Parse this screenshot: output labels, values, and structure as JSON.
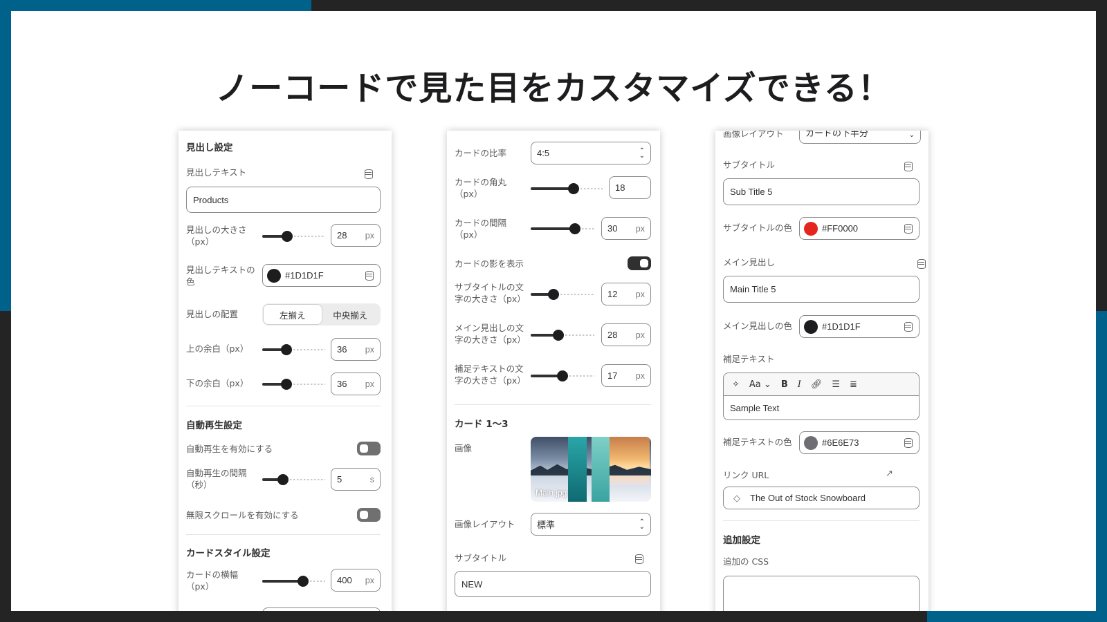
{
  "headline": "ノーコードで見た目をカスタマイズできる！",
  "colors": {
    "accent_blue": "#00628a",
    "dark": "#1d1d1f",
    "red": "#FF0000",
    "gray": "#6E6E73"
  },
  "icons": [
    "database-icon",
    "chevron-updown-icon",
    "external-link-icon",
    "tag-icon",
    "magic-icon",
    "bold-icon",
    "italic-icon",
    "link-icon",
    "bullet-list-icon",
    "numbered-list-icon"
  ],
  "panel1": {
    "heading_section": "見出し設定",
    "heading_text_label": "見出しテキスト",
    "heading_text_value": "Products",
    "heading_size_label": "見出しの大きさ（px）",
    "heading_size_value": "28",
    "heading_size_fraction": 0.4,
    "unit_px": "px",
    "heading_color_label": "見出しテキストの色",
    "heading_color_value": "#1D1D1F",
    "alignment_label": "見出しの配置",
    "alignment_options": [
      "左揃え",
      "中央揃え"
    ],
    "alignment_selected": "左揃え",
    "top_margin_label": "上の余白（px）",
    "top_margin_value": "36",
    "top_margin_fraction": 0.38,
    "bottom_margin_label": "下の余白（px）",
    "bottom_margin_value": "36",
    "bottom_margin_fraction": 0.38,
    "autoplay_section": "自動再生設定",
    "autoplay_enable_label": "自動再生を有効にする",
    "autoplay_enable_on": false,
    "autoplay_interval_label": "自動再生の間隔（秒）",
    "autoplay_interval_value": "5",
    "autoplay_interval_fraction": 0.33,
    "unit_s": "s",
    "infinite_scroll_label": "無限スクロールを有効にする",
    "infinite_scroll_on": false,
    "card_style_section": "カードスタイル設定",
    "card_width_label": "カードの横幅（px）",
    "card_width_value": "400",
    "card_width_fraction": 0.65
  },
  "panel2": {
    "ratio_label": "カードの比率",
    "ratio_value": "4:5",
    "corner_label": "カードの角丸（px）",
    "corner_value": "18",
    "corner_fraction": 0.6,
    "gap_label": "カードの間隔（px）",
    "gap_value": "30",
    "gap_fraction": 0.7,
    "unit_px": "px",
    "shadow_label": "カードの影を表示",
    "shadow_on": true,
    "subtitle_size_label": "サブタイトルの文字の大きさ（px）",
    "subtitle_size_value": "12",
    "subtitle_size_fraction": 0.36,
    "main_size_label": "メイン見出しの文字の大きさ（px）",
    "main_size_value": "28",
    "main_size_fraction": 0.44,
    "supp_size_label": "補足テキストの文字の大きさ（px）",
    "supp_size_value": "17",
    "supp_size_fraction": 0.5,
    "cards_section": "カード 1〜3",
    "image_label": "画像",
    "image_caption": "Main.jpg",
    "image_layout_label": "画像レイアウト",
    "image_layout_value": "標準",
    "subtitle_label": "サブタイトル",
    "subtitle_value": "NEW"
  },
  "panel3": {
    "image_layout_label": "画像レイアウト",
    "image_layout_value": "カードの下半分",
    "subtitle_label": "サブタイトル",
    "subtitle_value": "Sub Title 5",
    "subtitle_color_label": "サブタイトルの色",
    "subtitle_color_value": "#FF0000",
    "main_label": "メイン見出し",
    "main_value": "Main Title 5",
    "main_color_label": "メイン見出しの色",
    "main_color_value": "#1D1D1F",
    "supp_label": "補足テキスト",
    "supp_font_label": "Aa",
    "supp_value": "Sample Text",
    "supp_color_label": "補足テキストの色",
    "supp_color_value": "#6E6E73",
    "link_label": "リンク URL",
    "link_value": "The Out of Stock Snowboard",
    "extra_section": "追加設定",
    "css_label": "追加の CSS"
  }
}
